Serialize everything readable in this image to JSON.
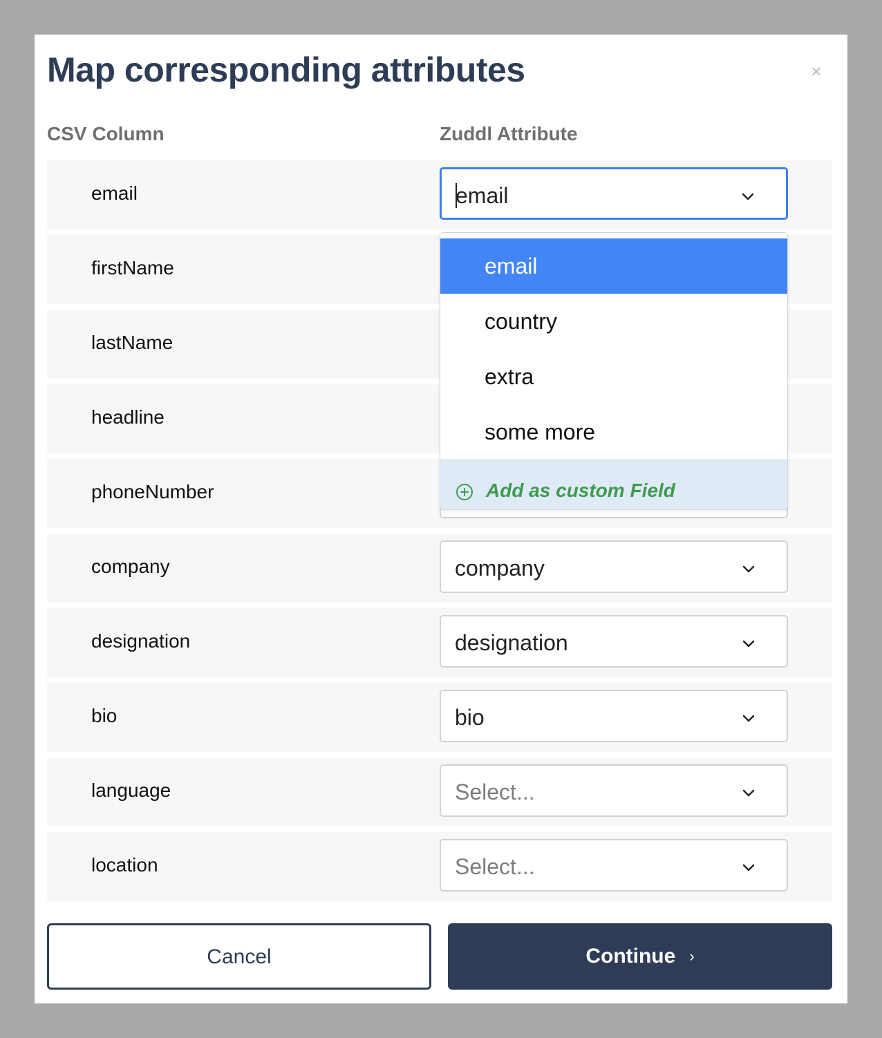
{
  "modal": {
    "title": "Map corresponding attributes",
    "close_icon": "×"
  },
  "columns": {
    "csv": "CSV Column",
    "attribute": "Zuddl Attribute"
  },
  "rows": [
    {
      "csv": "email",
      "value": "email",
      "placeholder": false
    },
    {
      "csv": "firstName",
      "value": "",
      "placeholder": false
    },
    {
      "csv": "lastName",
      "value": "",
      "placeholder": false
    },
    {
      "csv": "headline",
      "value": "",
      "placeholder": false
    },
    {
      "csv": "phoneNumber",
      "value": "",
      "placeholder": false
    },
    {
      "csv": "company",
      "value": "company",
      "placeholder": false
    },
    {
      "csv": "designation",
      "value": "designation",
      "placeholder": false
    },
    {
      "csv": "bio",
      "value": "bio",
      "placeholder": false
    },
    {
      "csv": "language",
      "value": "Select...",
      "placeholder": true
    },
    {
      "csv": "location",
      "value": "Select...",
      "placeholder": true
    }
  ],
  "dropdown": {
    "options": [
      "email",
      "country",
      "extra",
      "some more"
    ],
    "active_option": "email",
    "custom_label": "Add as custom Field",
    "custom_icon": "plus-circle-icon"
  },
  "buttons": {
    "cancel": "Cancel",
    "continue": "Continue",
    "continue_icon": "›"
  },
  "colors": {
    "primary": "#2e3d55",
    "focus": "#3d7fef",
    "option_active": "#4385f5",
    "custom_green": "#3f9a4f",
    "overlay": "#a8a8a8"
  }
}
